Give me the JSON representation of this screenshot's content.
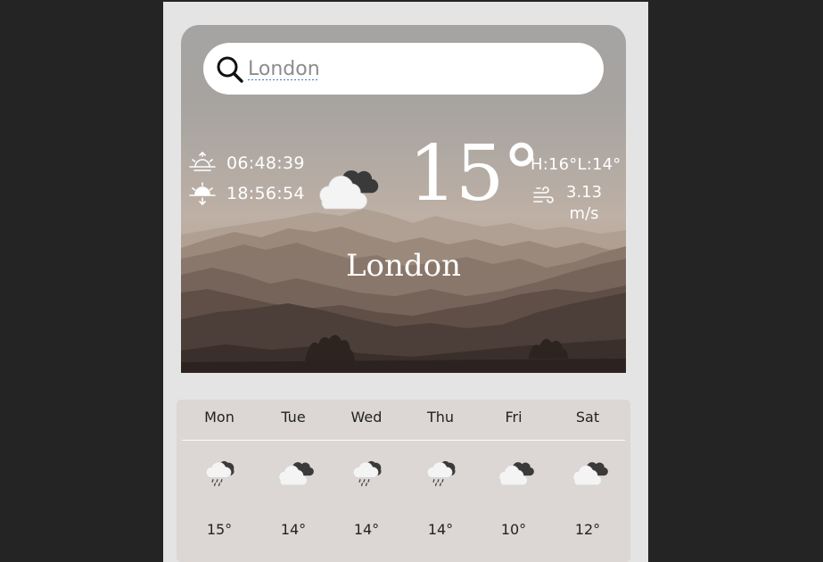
{
  "search": {
    "value": "London",
    "icon": "search-icon"
  },
  "current": {
    "sunrise": "06:48:39",
    "sunset": "18:56:54",
    "temperature": "15°",
    "high_low": "H:16°L:14°",
    "wind_speed": "3.13",
    "wind_unit": "m/s",
    "city": "London",
    "condition_icon": "cloudy-icon"
  },
  "forecast": [
    {
      "day": "Mon",
      "temp": "15°",
      "icon": "rain-icon"
    },
    {
      "day": "Tue",
      "temp": "14°",
      "icon": "cloudy-icon"
    },
    {
      "day": "Wed",
      "temp": "14°",
      "icon": "rain-icon"
    },
    {
      "day": "Thu",
      "temp": "14°",
      "icon": "rain-icon"
    },
    {
      "day": "Fri",
      "temp": "10°",
      "icon": "cloudy-icon"
    },
    {
      "day": "Sat",
      "temp": "12°",
      "icon": "cloudy-icon"
    }
  ],
  "colors": {
    "page_background": "#e4e4e4",
    "outer_background": "#242424",
    "forecast_background": "#dcd7d4",
    "text_light": "#ffffff",
    "text_dark": "#222222"
  }
}
